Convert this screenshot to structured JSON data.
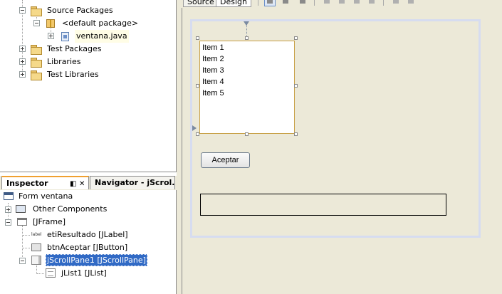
{
  "project_tree": {
    "items": [
      {
        "label": "Source Packages"
      },
      {
        "label": "<default package>"
      },
      {
        "label": "ventana.java"
      },
      {
        "label": "Test Packages"
      },
      {
        "label": "Libraries"
      },
      {
        "label": "Test Libraries"
      }
    ]
  },
  "inspector": {
    "tab_inspector": "Inspector",
    "tab_navigator": "Navigator - jScrol...",
    "pin_icon": "◧",
    "close_glyph": "✕",
    "nodes": [
      {
        "label": "Form ventana"
      },
      {
        "label": "Other Components"
      },
      {
        "label": "[JFrame]"
      },
      {
        "label": "etiResultado [JLabel]"
      },
      {
        "label": "btnAceptar [JButton]"
      },
      {
        "label": "jScrollPane1 [JScrollPane]"
      },
      {
        "label": "jList1 [JList]"
      }
    ],
    "label_icon_text": "label"
  },
  "editor": {
    "tabs": [
      {
        "label": "Source"
      },
      {
        "label": "Design",
        "active": true
      }
    ],
    "list_items": [
      "Item 1",
      "Item 2",
      "Item 3",
      "Item 4",
      "Item 5"
    ],
    "button_label": "Aceptar",
    "result_label_text": ""
  },
  "colors": {
    "selection": "#316ac5",
    "panel_bg": "#ece9d8",
    "canvas_frame": "#d6dcf0",
    "selected_component_border": "#c8a046"
  }
}
